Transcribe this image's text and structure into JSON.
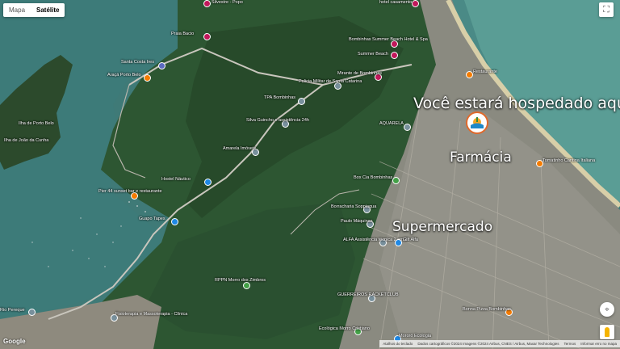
{
  "map_type": {
    "map_label": "Mapa",
    "satellite_label": "Satélite",
    "active": "satellite"
  },
  "overlays": {
    "hotel": "Você estará hospedado aqui!",
    "pharmacy": "Farmácia",
    "supermarket": "Supermercado"
  },
  "places": [
    {
      "id": "silvestre",
      "name": "Silvestre - Popo",
      "color": "#c2185b"
    },
    {
      "id": "hotel-casamento",
      "name": "hotel casamento",
      "color": "#c2185b"
    },
    {
      "id": "praia-bacio",
      "name": "Praia Bacio",
      "color": "#c2185b"
    },
    {
      "id": "bombinhas-summer-beach",
      "name": "Bombinhas Summer Beach Hotel & Spa",
      "color": "#c2185b"
    },
    {
      "id": "summer-beach",
      "name": "Summer Beach",
      "color": "#c2185b"
    },
    {
      "id": "santa-costa",
      "name": "Santa Costa Ires",
      "color": "#5c6bc0"
    },
    {
      "id": "araca-porto-belo",
      "name": "Araçá Porto Belo",
      "color": "#f57c00"
    },
    {
      "id": "mirante-bombinhas",
      "name": "Mirante de Bombinhas",
      "color": "#c2185b"
    },
    {
      "id": "policia-militar",
      "name": "Policia Militar de Santa Catarina",
      "color": "#78909c"
    },
    {
      "id": "tpa-bombinhas",
      "name": "TPA Bombinhas",
      "color": "#78909c"
    },
    {
      "id": "restaurante-beach",
      "name": "Restaurante",
      "color": "#f57c00"
    },
    {
      "id": "silva-guincho",
      "name": "Silva Guincho e assistência 24h",
      "color": "#78909c"
    },
    {
      "id": "aquarela",
      "name": "AQUARELA",
      "color": "#78909c"
    },
    {
      "id": "ilha-porto-belo",
      "name": "Ilha de Porto Belo",
      "color": ""
    },
    {
      "id": "ilha-joao-cunha",
      "name": "Ilha de João da Cunha",
      "color": ""
    },
    {
      "id": "amarela-imoveis",
      "name": "Amarela Imóveis",
      "color": "#78909c"
    },
    {
      "id": "hostel-nautico",
      "name": "Hostel Náutico",
      "color": "#1e88e5"
    },
    {
      "id": "pier-44",
      "name": "Pier 44 sunset bar e restaurante",
      "color": "#f57c00"
    },
    {
      "id": "guapo-tapes",
      "name": "Guapo Tapes",
      "color": "#1e88e5"
    },
    {
      "id": "box-cia",
      "name": "Box Cia Bombinhas",
      "color": "#43a047"
    },
    {
      "id": "borracharia",
      "name": "Borracharia Soppiaqua",
      "color": "#78909c"
    },
    {
      "id": "paulo-maquinas",
      "name": "Paulo Máquinas",
      "color": "#78909c"
    },
    {
      "id": "alfa-assistencia",
      "name": "ALFA Assistência técnica 2 em 1",
      "color": "#78909c"
    },
    {
      "id": "gilt-alfa",
      "name": "Gilt Alfa",
      "color": "#1e88e5"
    },
    {
      "id": "rppn",
      "name": "RPPN Morro dos Zimbros",
      "color": "#43a047"
    },
    {
      "id": "guerreiros-racketclub",
      "name": "GUERREIROS RACKETCLUB",
      "color": "#78909c"
    },
    {
      "id": "fisioterapia",
      "name": "Fisioterapia e Massoterapia - Clínica",
      "color": "#78909c"
    },
    {
      "id": "bonna-pizza",
      "name": "Bonna Pizza Bombinhas",
      "color": "#f57c00"
    },
    {
      "id": "ecologica",
      "name": "Ecológica Morro Cristiano",
      "color": "#43a047"
    },
    {
      "id": "rio-pereque",
      "name": "Rio Pereque",
      "color": "#78909c"
    },
    {
      "id": "mororo-ecologia",
      "name": "Mororó Ecologia",
      "color": "#1e88e5"
    },
    {
      "id": "tomatinho",
      "name": "Tomatinho Cantina Italiana",
      "color": "#f57c00"
    }
  ],
  "footer": {
    "shortcuts": "Atalhos do teclado",
    "attribution": "Dados cartográficos ©2024 Imagens ©2024 Airbus, CNES / Airbus, Maxar Technologies",
    "terms": "Termos",
    "report": "Informar erro no mapa"
  },
  "google_logo": "Google"
}
